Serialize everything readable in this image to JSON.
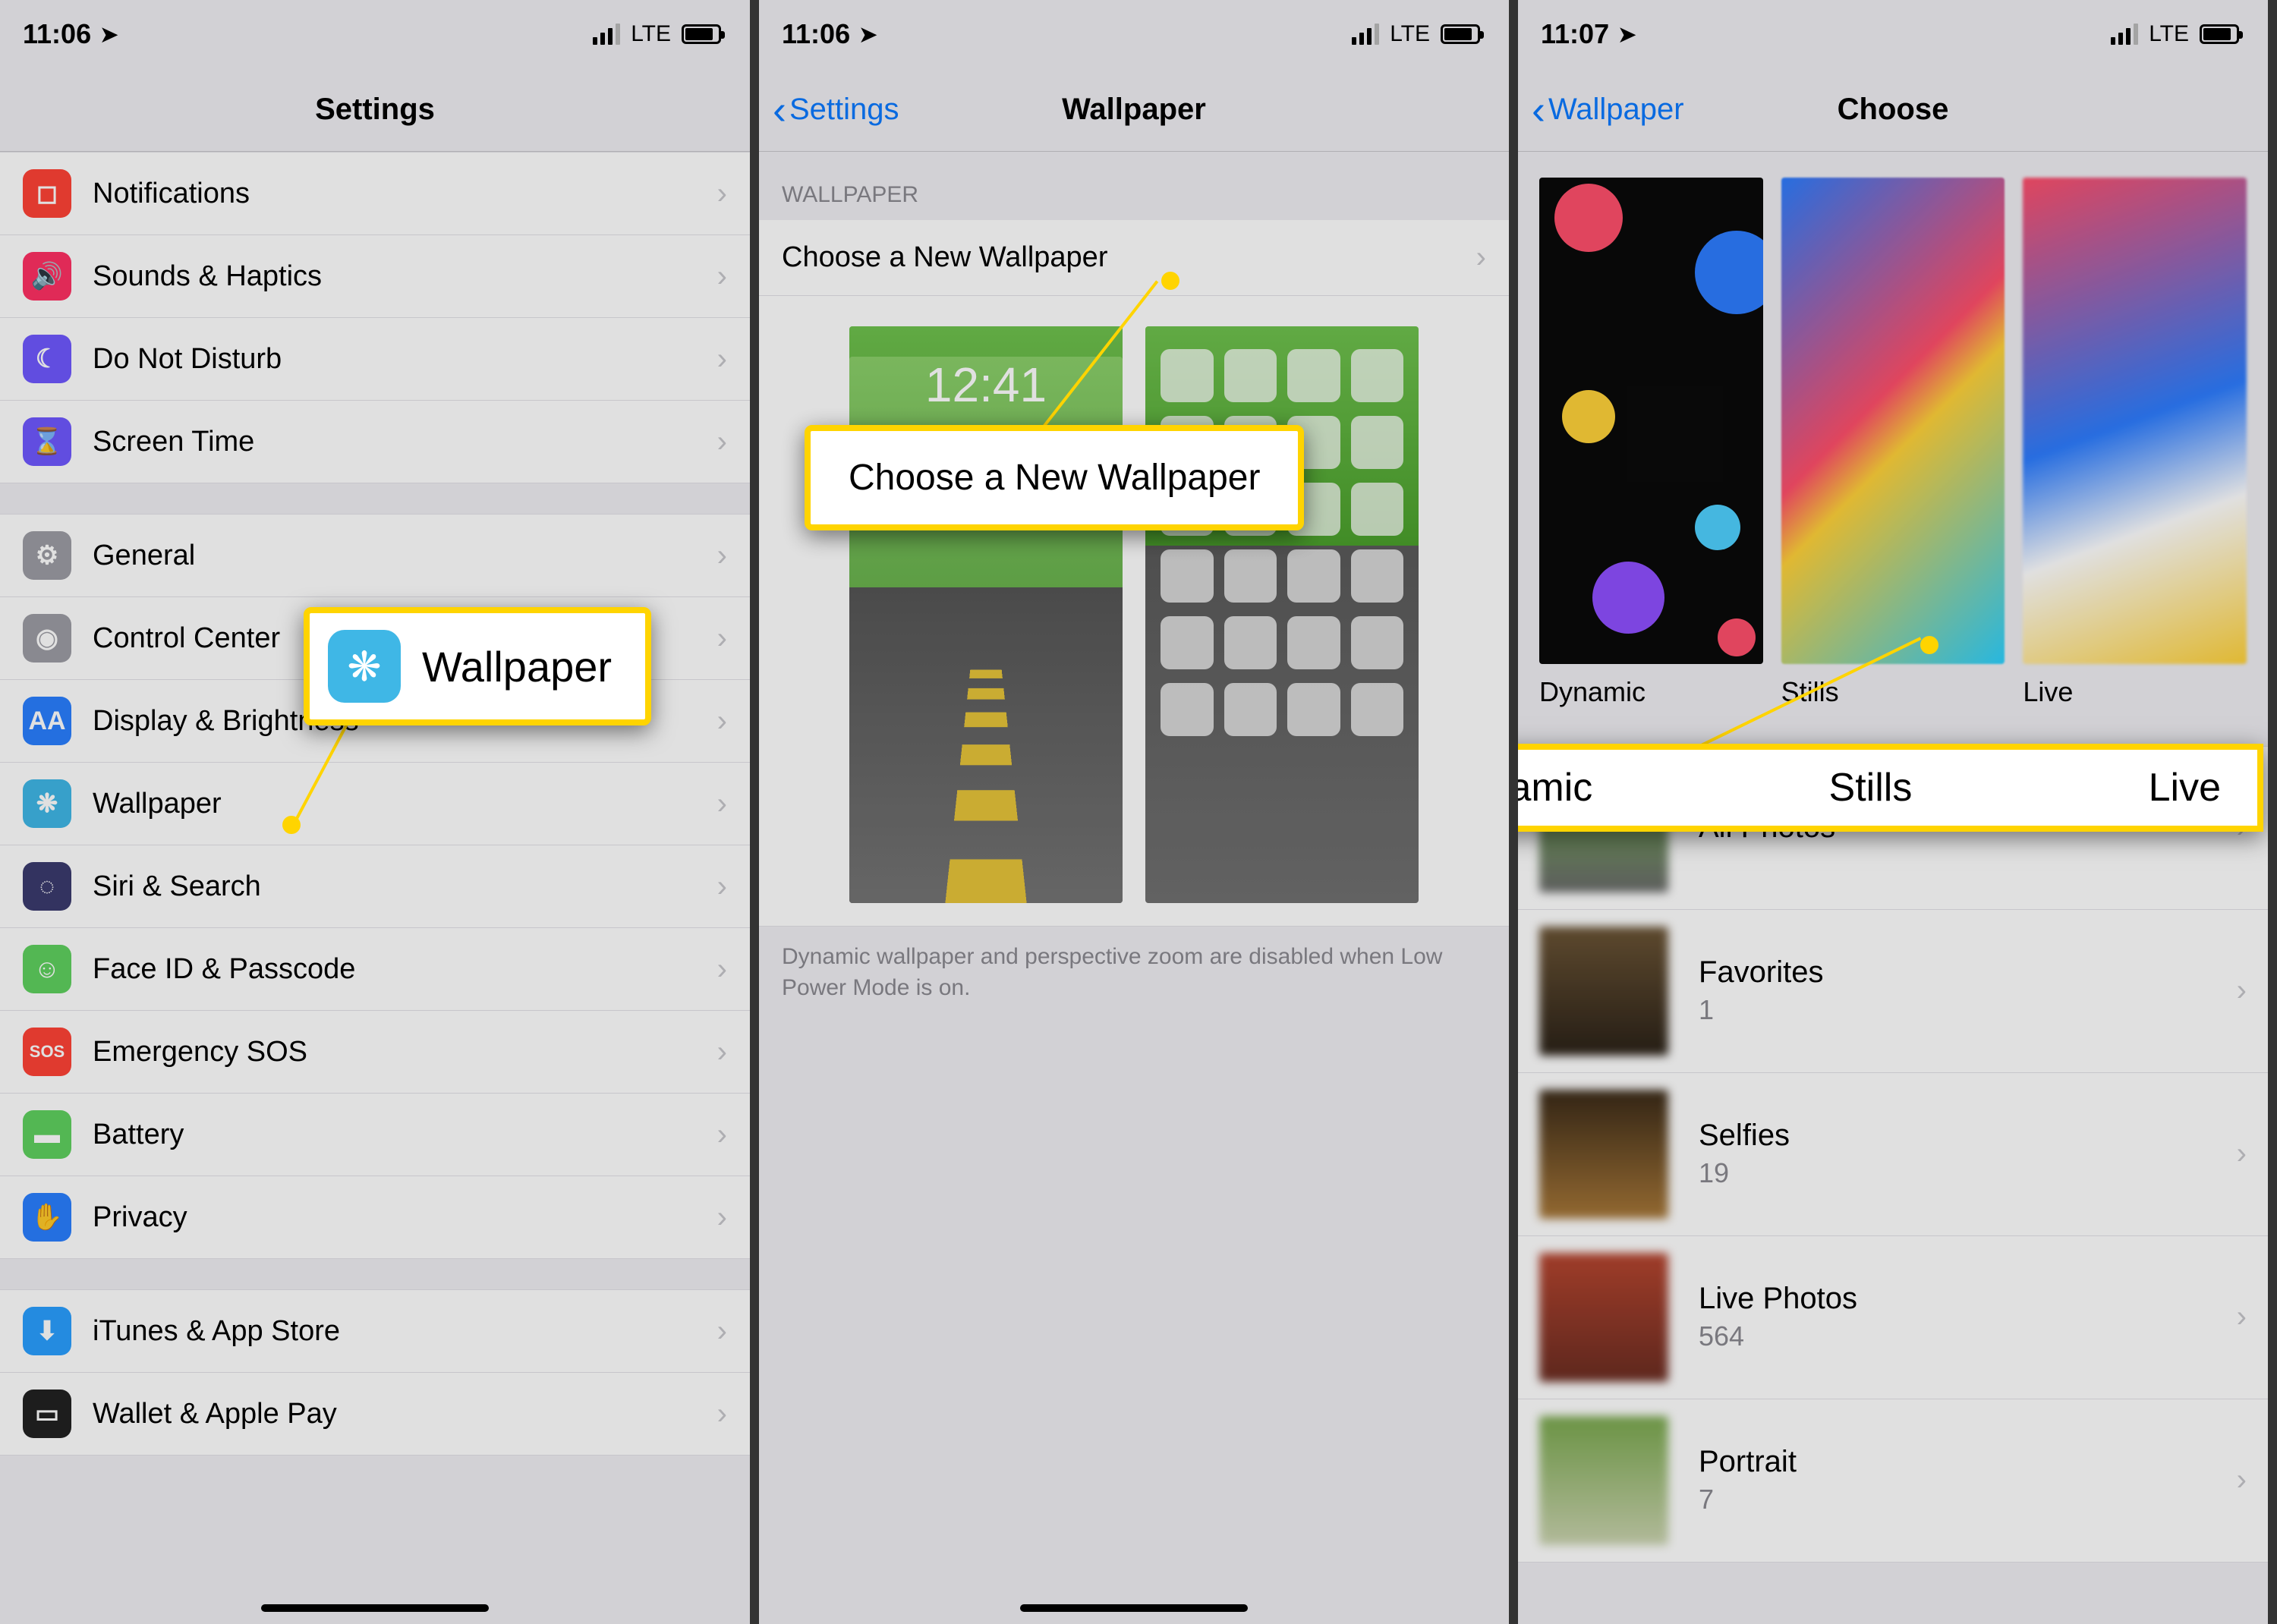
{
  "status": {
    "time1": "11:06",
    "time2": "11:06",
    "time3": "11:07",
    "network": "LTE"
  },
  "screen1": {
    "title": "Settings",
    "rows_group1": [
      {
        "name": "Notifications",
        "iconColor": "#ff4336",
        "glyph": "◻︎"
      },
      {
        "name": "Sounds & Haptics",
        "iconColor": "#ff3064",
        "glyph": "🔊"
      },
      {
        "name": "Do Not Disturb",
        "iconColor": "#6f58ff",
        "glyph": "☾"
      },
      {
        "name": "Screen Time",
        "iconColor": "#6f58ff",
        "glyph": "⌛"
      }
    ],
    "rows_group2": [
      {
        "name": "General",
        "iconColor": "#9d9da4",
        "glyph": "⚙"
      },
      {
        "name": "Control Center",
        "iconColor": "#9d9da4",
        "glyph": "◉"
      },
      {
        "name": "Display & Brightness",
        "iconColor": "#2a7fff",
        "glyph": "AA"
      },
      {
        "name": "Wallpaper",
        "iconColor": "#3fb7e6",
        "glyph": "❋"
      },
      {
        "name": "Siri & Search",
        "iconColor": "#3b3b6e",
        "glyph": "◌"
      },
      {
        "name": "Face ID & Passcode",
        "iconColor": "#5fd15f",
        "glyph": "☺"
      },
      {
        "name": "Emergency SOS",
        "iconColor": "#ff4336",
        "glyph": "SOS"
      },
      {
        "name": "Battery",
        "iconColor": "#5fd15f",
        "glyph": "▬"
      },
      {
        "name": "Privacy",
        "iconColor": "#2a7fff",
        "glyph": "✋"
      }
    ],
    "rows_group3": [
      {
        "name": "iTunes & App Store",
        "iconColor": "#2a9fff",
        "glyph": "⬇"
      },
      {
        "name": "Wallet & Apple Pay",
        "iconColor": "#222",
        "glyph": "▭"
      }
    ],
    "highlight": {
      "label": "Wallpaper"
    }
  },
  "screen2": {
    "back": "Settings",
    "title": "Wallpaper",
    "section_header": "WALLPAPER",
    "choose_row": "Choose a New Wallpaper",
    "lock_time": "12:41",
    "footer": "Dynamic wallpaper and perspective zoom are disabled when Low Power Mode is on.",
    "highlight": {
      "label": "Choose a New Wallpaper"
    }
  },
  "screen3": {
    "back": "Wallpaper",
    "title": "Choose",
    "categories": [
      {
        "name": "Dynamic"
      },
      {
        "name": "Stills"
      },
      {
        "name": "Live"
      }
    ],
    "albums": [
      {
        "name": "All Photos",
        "count": ""
      },
      {
        "name": "Favorites",
        "count": "1"
      },
      {
        "name": "Selfies",
        "count": "19"
      },
      {
        "name": "Live Photos",
        "count": "564"
      },
      {
        "name": "Portrait",
        "count": "7"
      }
    ],
    "highlight": [
      "Dynamic",
      "Stills",
      "Live"
    ]
  }
}
